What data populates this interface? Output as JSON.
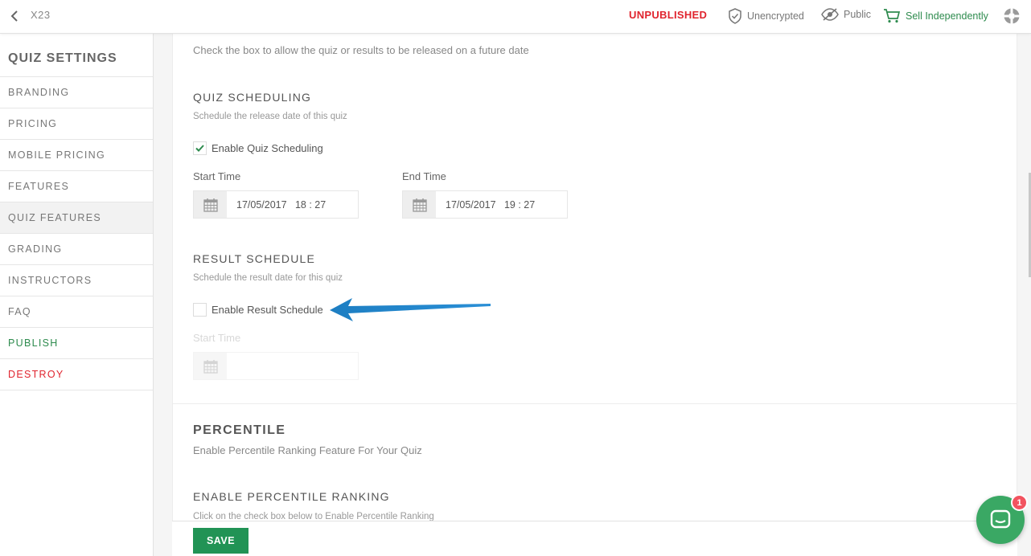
{
  "topbar": {
    "quiz_name": "X23",
    "status": "UNPUBLISHED",
    "encryption_label": "Unencrypted",
    "visibility_label": "Public",
    "sell_label": "Sell Independently",
    "status_color": "#e0242e",
    "accent_color": "#2e8b4e"
  },
  "sidebar": {
    "title": "QUIZ SETTINGS",
    "items": [
      {
        "label": "BRANDING"
      },
      {
        "label": "PRICING"
      },
      {
        "label": "MOBILE PRICING"
      },
      {
        "label": "FEATURES"
      },
      {
        "label": "QUIZ FEATURES"
      },
      {
        "label": "GRADING"
      },
      {
        "label": "INSTRUCTORS"
      },
      {
        "label": "FAQ"
      },
      {
        "label": "PUBLISH"
      },
      {
        "label": "DESTROY"
      }
    ]
  },
  "scheduling": {
    "description": "Check the box to allow the quiz or results to be released on a future date"
  },
  "quiz_scheduling": {
    "title": "QUIZ SCHEDULING",
    "description": "Schedule the release date of this quiz",
    "checkbox_label": "Enable Quiz Scheduling",
    "checked": true,
    "start_label": "Start Time",
    "start_value": "17/05/2017   18 : 27",
    "end_label": "End Time",
    "end_value": "17/05/2017   19 : 27"
  },
  "result_schedule": {
    "title": "RESULT SCHEDULE",
    "description": "Schedule the result date for this quiz",
    "checkbox_label": "Enable Result Schedule",
    "checked": false,
    "start_label": "Start Time"
  },
  "percentile": {
    "title": "PERCENTILE",
    "description": "Enable Percentile Ranking Feature For Your Quiz",
    "ranking_title": "ENABLE PERCENTILE RANKING",
    "ranking_description": "Click on the check box below to Enable Percentile Ranking"
  },
  "footer": {
    "save_label": "SAVE"
  },
  "chat": {
    "badge_count": "1"
  }
}
